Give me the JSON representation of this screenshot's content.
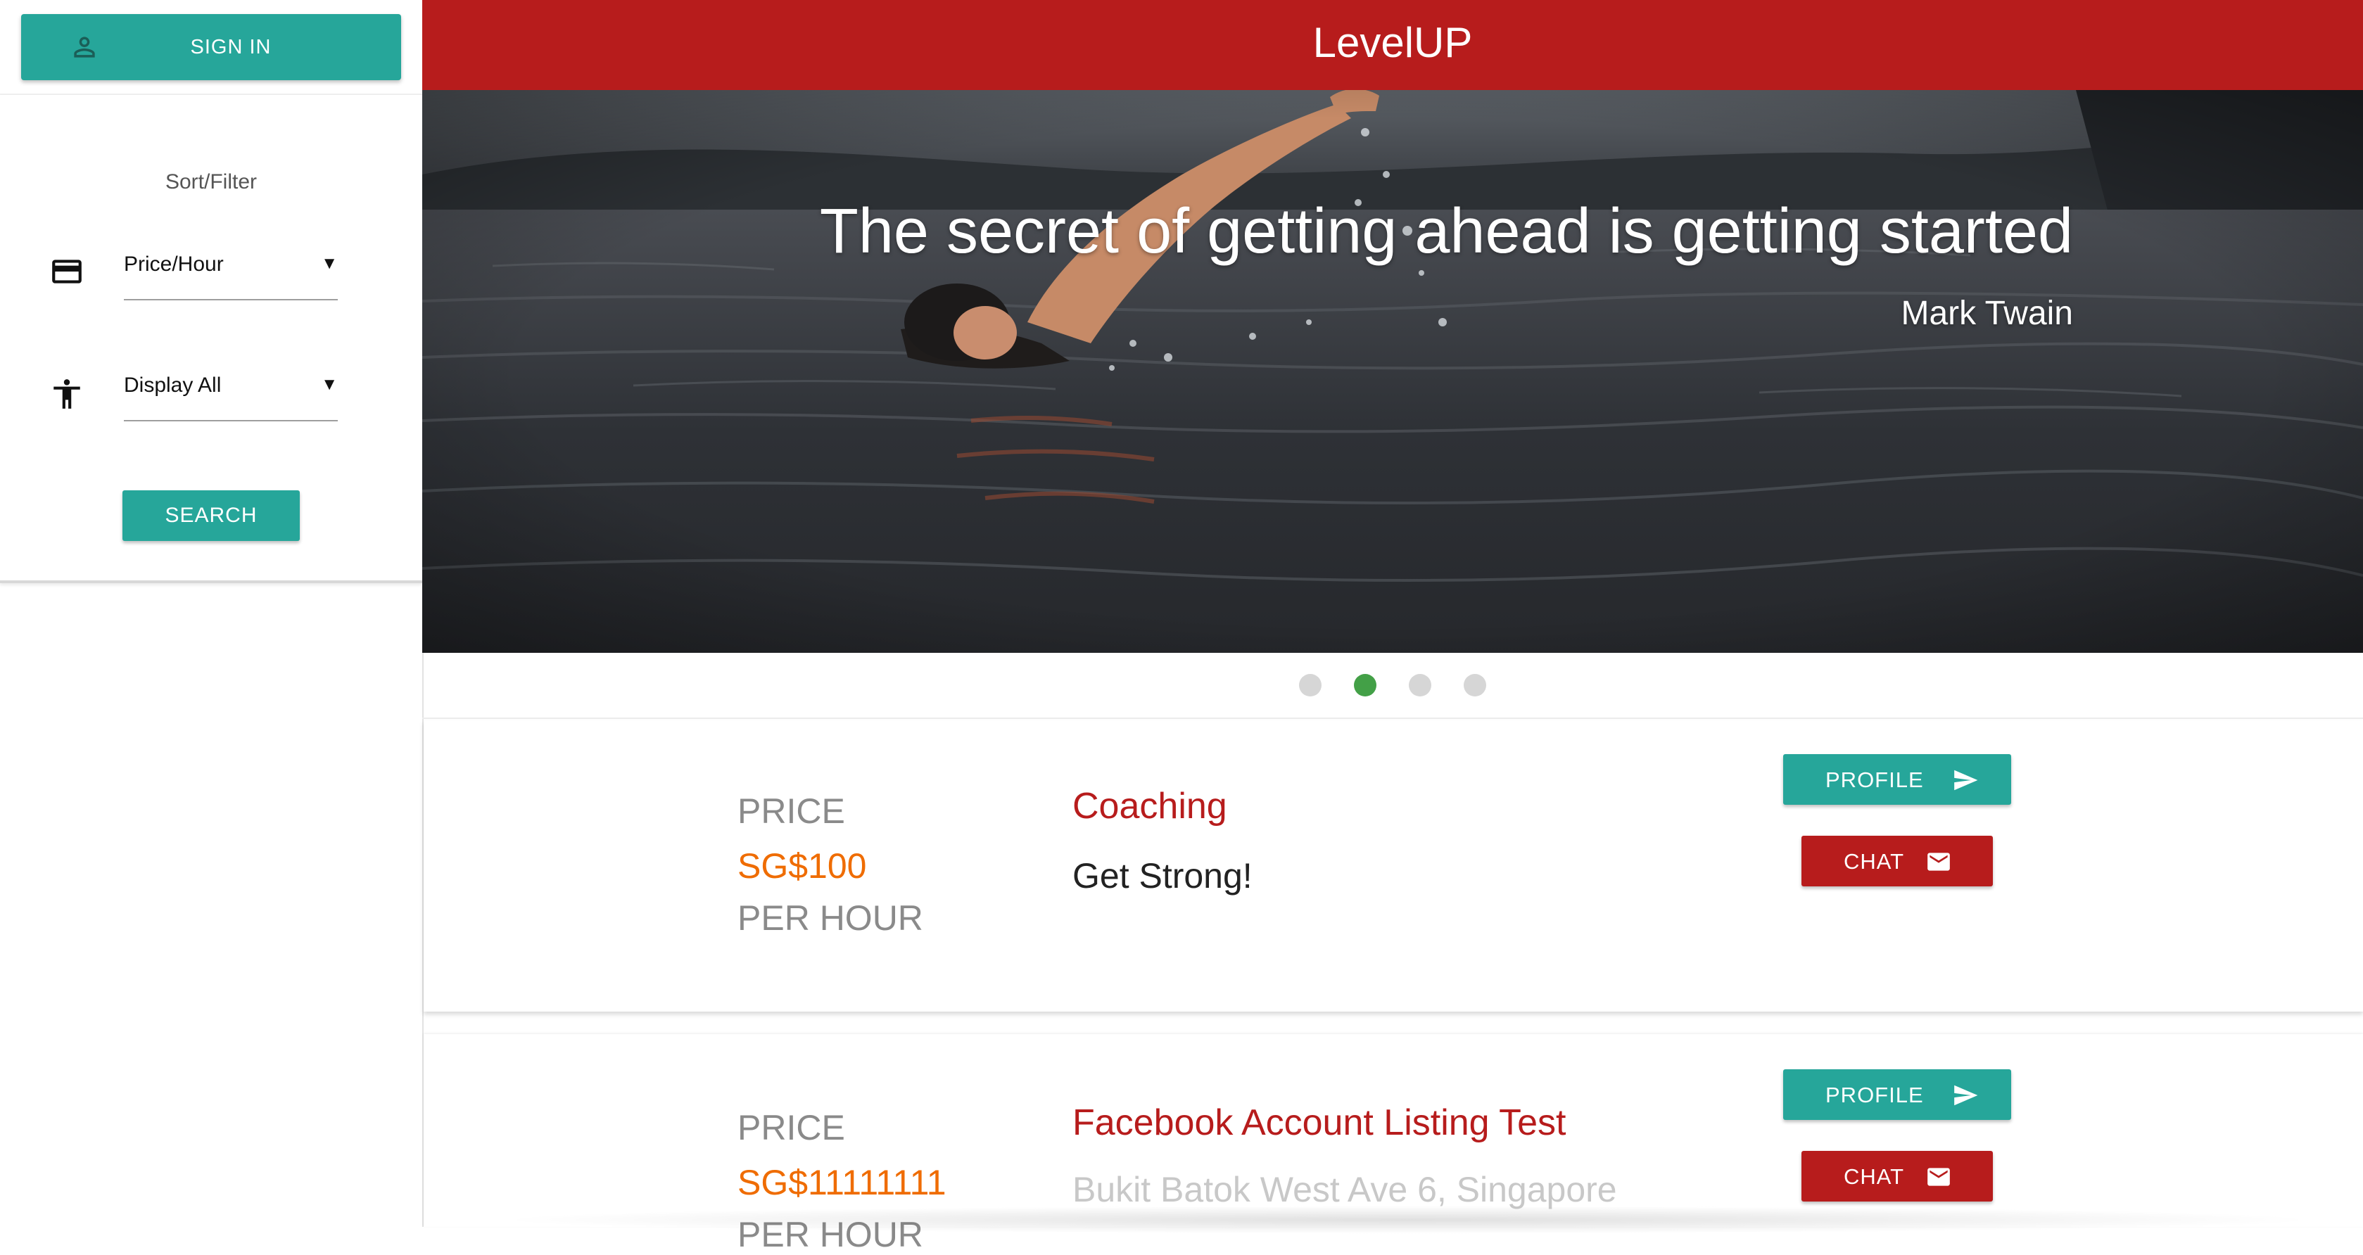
{
  "sidebar": {
    "signin_label": "SIGN IN",
    "sort_title": "Sort/Filter",
    "price_select_value": "Price/Hour",
    "category_select_value": "Display All",
    "search_label": "SEARCH"
  },
  "header": {
    "title": "LevelUP"
  },
  "hero": {
    "quote": "The secret of getting ahead is getting started",
    "author": "Mark Twain",
    "active_slide": 2,
    "slide_count": 4
  },
  "listings": [
    {
      "price_label": "PRICE",
      "price": "SG$100",
      "per_hour": "PER HOUR",
      "title": "Coaching",
      "description": "Get Strong!",
      "profile_label": "PROFILE",
      "chat_label": "CHAT"
    },
    {
      "price_label": "PRICE",
      "price": "SG$11111111",
      "per_hour": "PER HOUR",
      "title": "Facebook Account Listing Test",
      "description": "Bukit Batok West Ave 6, Singapore",
      "profile_label": "PROFILE",
      "chat_label": "CHAT"
    }
  ],
  "colors": {
    "header_red": "#b71c1c",
    "teal": "#26a69a",
    "price_orange": "#ef6c00",
    "active_dot": "#43a047"
  },
  "icons": [
    "person-icon",
    "credit-card-icon",
    "accessibility-icon",
    "send-icon",
    "email-icon"
  ]
}
